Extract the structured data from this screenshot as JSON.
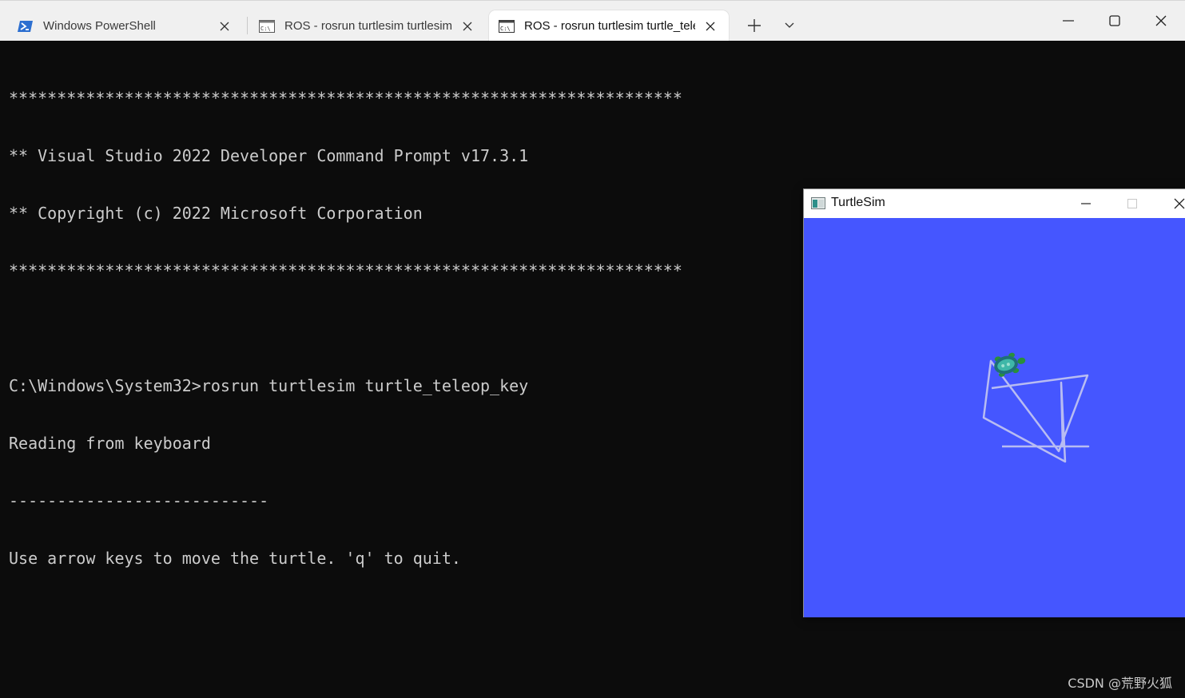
{
  "tabs": [
    {
      "title": "Windows PowerShell",
      "icon": "powershell-icon",
      "active": false
    },
    {
      "title": "ROS - rosrun  turtlesim turtlesim",
      "icon": "command-prompt-icon",
      "active": false
    },
    {
      "title": "ROS - rosrun  turtlesim turtle_teleop_key",
      "icon": "command-prompt-icon",
      "active": true
    }
  ],
  "terminal": {
    "lines": [
      "**********************************************************************",
      "** Visual Studio 2022 Developer Command Prompt v17.3.1",
      "** Copyright (c) 2022 Microsoft Corporation",
      "**********************************************************************",
      "",
      "C:\\Windows\\System32>rosrun turtlesim turtle_teleop_key",
      "Reading from keyboard",
      "---------------------------",
      "Use arrow keys to move the turtle. 'q' to quit."
    ],
    "background": "#0c0c0c",
    "foreground": "#cccccc"
  },
  "turtlesim": {
    "title": "TurtleSim",
    "background": "#4556ff",
    "path_color": "#b8bcf2"
  },
  "watermark": "CSDN @荒野火狐"
}
